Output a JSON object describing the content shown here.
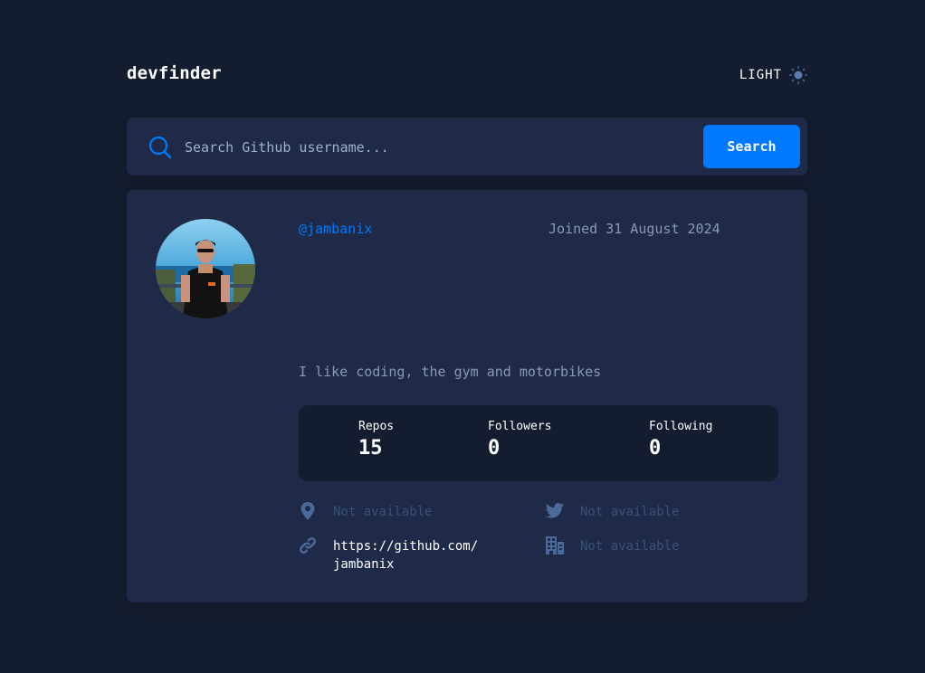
{
  "header": {
    "logo": "devfinder",
    "theme_label": "LIGHT"
  },
  "search": {
    "placeholder": "Search Github username...",
    "value": "",
    "button_label": "Search"
  },
  "profile": {
    "username": "@jambanix",
    "joined": "Joined 31 August 2024",
    "bio": "I like coding, the gym and motorbikes",
    "stats": {
      "repos_label": "Repos",
      "repos": "15",
      "followers_label": "Followers",
      "followers": "0",
      "following_label": "Following",
      "following": "0"
    },
    "links": {
      "location": "Not available",
      "twitter": "Not available",
      "blog_line1": "https://github.com/",
      "blog_line2": "jambanix",
      "company": "Not available"
    }
  },
  "colors": {
    "background": "#141d2f",
    "card": "#1e2a47",
    "accent": "#0079ff",
    "muted_text": "#8b98b3",
    "unavailable": "#4b6a9b"
  },
  "icons": [
    "sun-icon",
    "search-icon",
    "location-icon",
    "twitter-icon",
    "link-icon",
    "company-icon"
  ]
}
